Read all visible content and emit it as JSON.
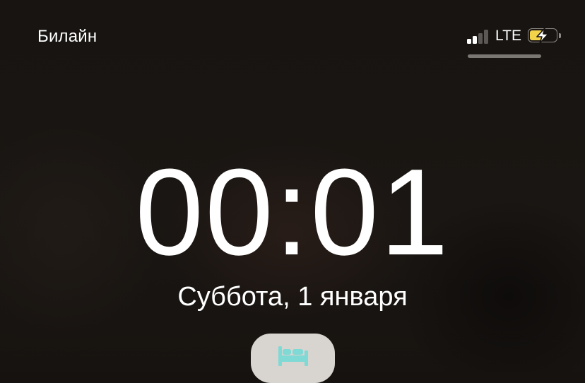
{
  "status_bar": {
    "carrier": "Билайн",
    "network": "LTE",
    "signal_bars_total": 4,
    "signal_bars_active": 2,
    "battery_level": 0.5,
    "battery_charging": true,
    "battery_color": "#f3d34a",
    "charging-icon": "bolt-icon"
  },
  "lock_screen": {
    "time": "00:01",
    "date": "Суббота, 1 января"
  },
  "sleep_widget": {
    "icon": "bed-icon",
    "icon_color": "#7fd9d5"
  }
}
